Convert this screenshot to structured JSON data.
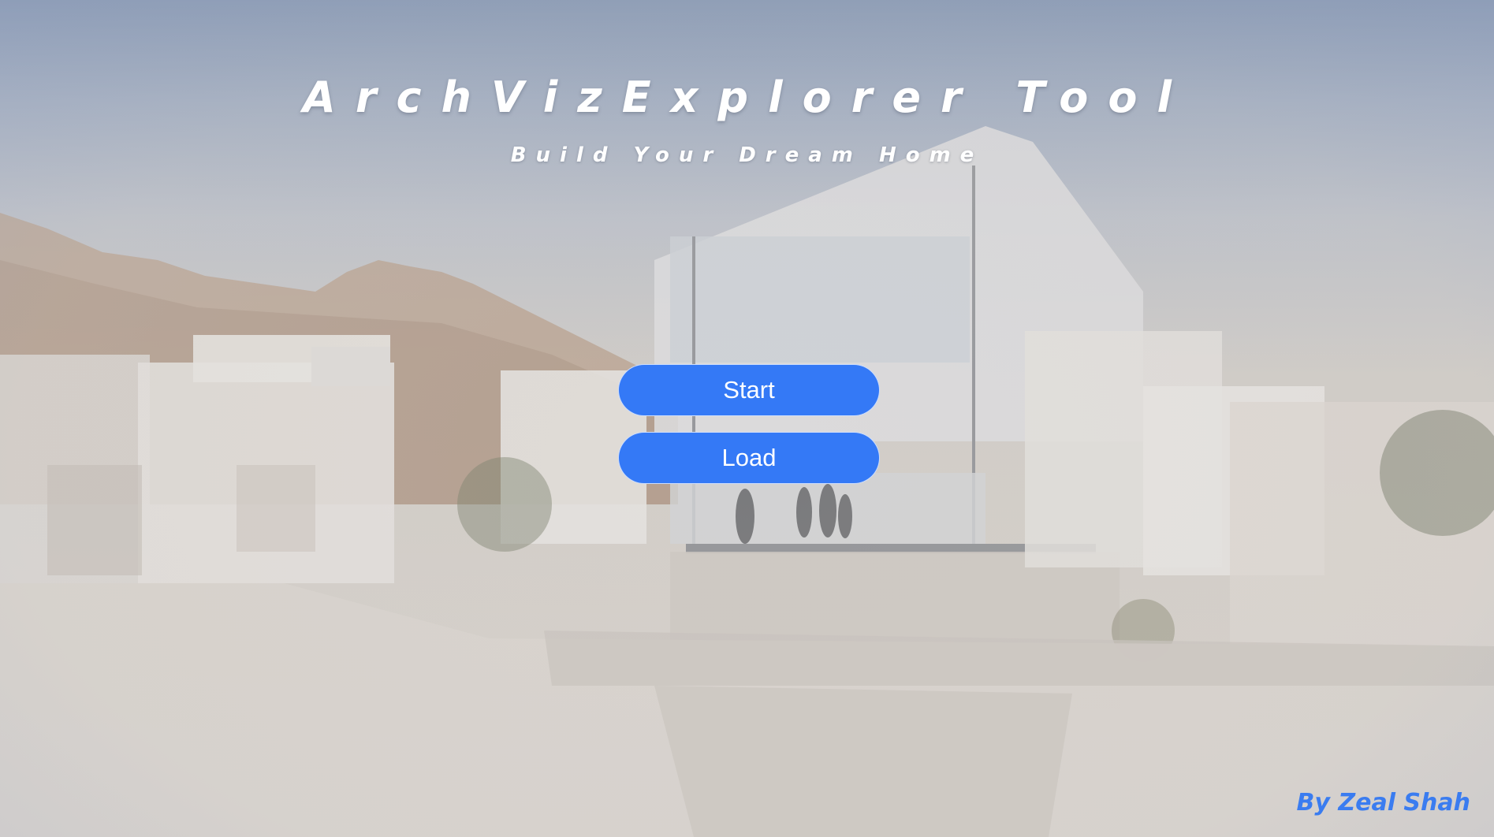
{
  "app": {
    "title": "ArchVizExplorer Tool",
    "subtitle": "Build Your Dream Home"
  },
  "menu": {
    "start_label": "Start",
    "load_label": "Load"
  },
  "credit": {
    "text": "By Zeal Shah"
  },
  "colors": {
    "button": "#3479f6",
    "credit": "#3a7cf0",
    "title": "#ffffff"
  }
}
